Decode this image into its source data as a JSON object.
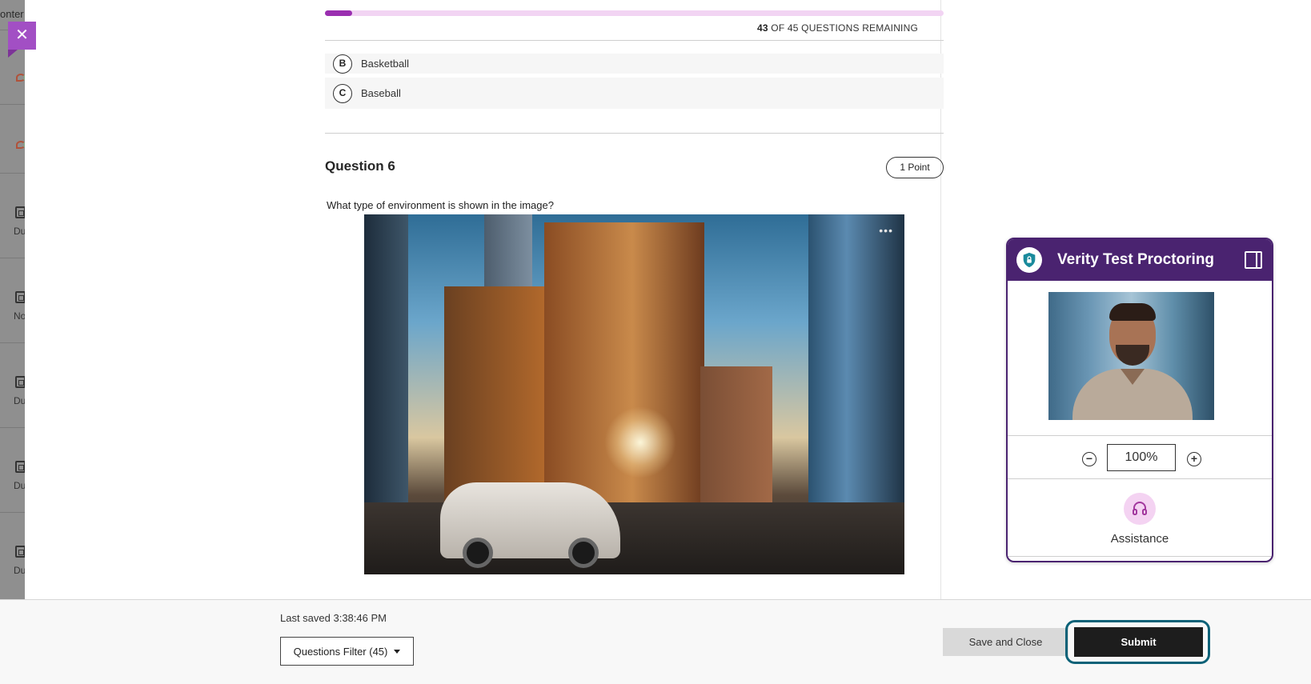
{
  "background": {
    "sidebar_text": "onter",
    "sidebar_items": [
      "Du",
      "No",
      "Du",
      "Du",
      "Du"
    ]
  },
  "close_button": {
    "label": "✕"
  },
  "progress": {
    "fraction_complete": 0.044,
    "remaining_count": "43",
    "remaining_suffix": " OF 45 QUESTIONS REMAINING"
  },
  "previous_question": {
    "options": [
      {
        "letter": "B",
        "text": "Basketball"
      },
      {
        "letter": "C",
        "text": "Baseball"
      }
    ]
  },
  "question": {
    "title": "Question 6",
    "points": "1 Point",
    "text": "What type of environment is shown in the image?",
    "image_menu": "•••"
  },
  "footer": {
    "last_saved": "Last saved 3:38:46 PM",
    "filter_label": "Questions Filter (45)",
    "save_close_label": "Save and Close",
    "submit_label": "Submit"
  },
  "proctoring": {
    "title": "Verity Test Proctoring",
    "zoom_value": "100%",
    "zoom_minus": "−",
    "zoom_plus": "+",
    "assistance_label": "Assistance"
  },
  "colors": {
    "accent_purple": "#9a2fb0",
    "proctor_header": "#4a2370",
    "submit_focus_ring": "#0c6278"
  }
}
